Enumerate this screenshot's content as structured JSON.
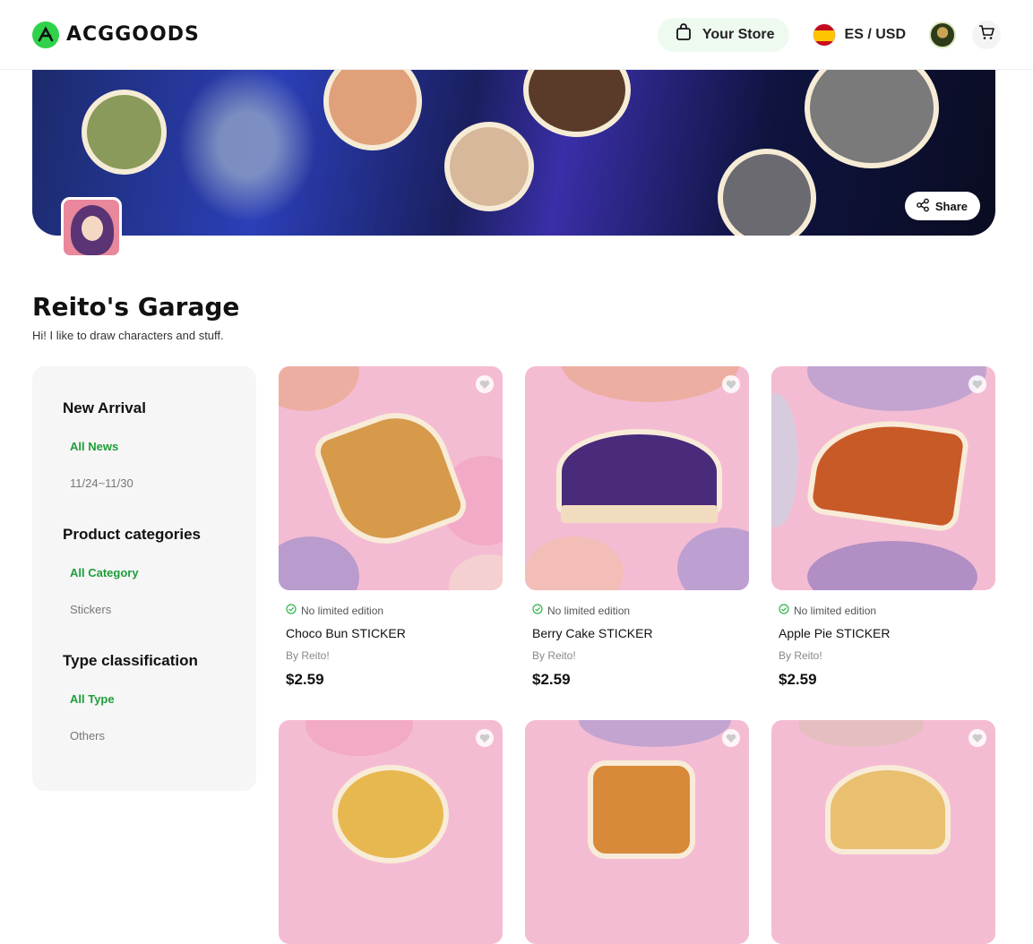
{
  "header": {
    "logo_text": "ACGGOODS",
    "store_button": "Your Store",
    "locale": "ES / USD"
  },
  "banner": {
    "share_label": "Share"
  },
  "store": {
    "title": "Reito's Garage",
    "description": "Hi! I like to draw characters and stuff."
  },
  "sidebar": {
    "groups": [
      {
        "heading": "New Arrival",
        "items": [
          {
            "label": "All News",
            "active": true
          },
          {
            "label": "11/24~11/30",
            "active": false
          }
        ]
      },
      {
        "heading": "Product categories",
        "items": [
          {
            "label": "All Category",
            "active": true
          },
          {
            "label": "Stickers",
            "active": false
          }
        ]
      },
      {
        "heading": "Type classification",
        "items": [
          {
            "label": "All Type",
            "active": true
          },
          {
            "label": "Others",
            "active": false
          }
        ]
      }
    ]
  },
  "products": [
    {
      "edition": "No limited edition",
      "name": "Choco Bun STICKER",
      "by": "By Reito!",
      "price": "$2.59"
    },
    {
      "edition": "No limited edition",
      "name": "Berry Cake STICKER",
      "by": "By Reito!",
      "price": "$2.59"
    },
    {
      "edition": "No limited edition",
      "name": "Apple Pie STICKER",
      "by": "By Reito!",
      "price": "$2.59"
    }
  ],
  "colors": {
    "accent": "#2fd24a",
    "active_link": "#1e9e3a",
    "product_bg": "#f4bcd3"
  }
}
